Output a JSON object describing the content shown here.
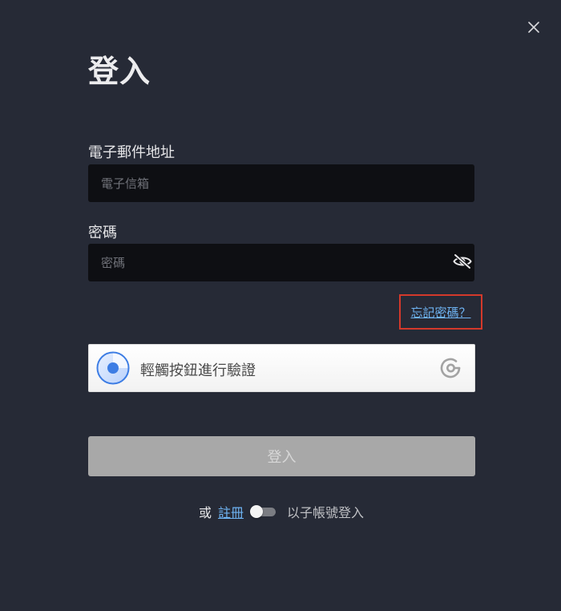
{
  "dialog": {
    "title": "登入",
    "close_icon": "close-icon"
  },
  "email": {
    "label": "電子郵件地址",
    "placeholder": "電子信箱",
    "value": ""
  },
  "password": {
    "label": "密碼",
    "placeholder": "密碼",
    "value": "",
    "visibility_icon": "eye-off-icon"
  },
  "forgot_password": {
    "label": "忘記密碼？",
    "highlight_color": "#d4392b"
  },
  "captcha": {
    "label": "輕觸按鈕進行驗證",
    "radio_icon": "radio-target-icon",
    "logo_icon": "geetest-logo-icon",
    "accent_color": "#3d7de4"
  },
  "submit": {
    "label": "登入"
  },
  "footer": {
    "or_text": "或",
    "register_label": "註冊",
    "subaccount_label": "以子帳號登入",
    "subaccount_toggle_on": false,
    "link_color": "#6eb3f2"
  }
}
